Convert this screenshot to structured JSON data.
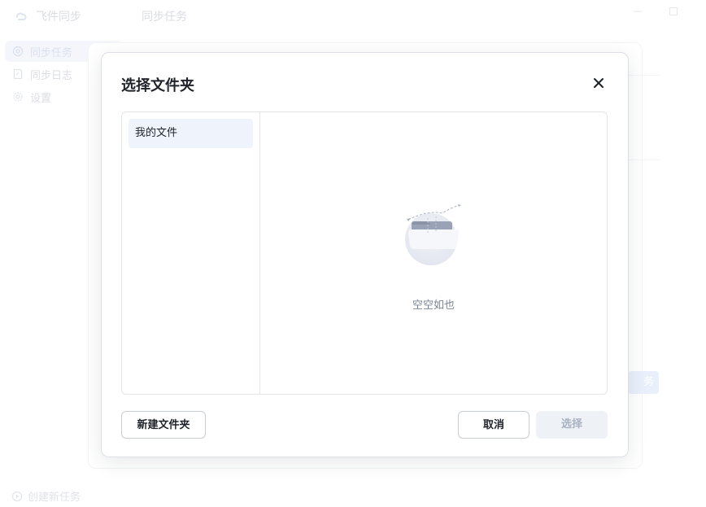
{
  "app": {
    "name": "飞件同步",
    "page_title": "同步任务",
    "sidebar": {
      "items": [
        {
          "label": "同步任务",
          "icon": "sync-icon",
          "active": true
        },
        {
          "label": "同步日志",
          "icon": "log-icon",
          "active": false
        },
        {
          "label": "设置",
          "icon": "gear-icon",
          "active": false
        }
      ]
    },
    "create_task_label": "创建新任务",
    "bg_button_label": "务"
  },
  "dialog": {
    "title": "选择文件夹",
    "close_icon": "close-icon",
    "tree": {
      "items": [
        {
          "label": "我的文件",
          "selected": true
        }
      ]
    },
    "empty_state": {
      "icon": "empty-folder-icon",
      "text": "空空如也"
    },
    "buttons": {
      "new_folder": "新建文件夹",
      "cancel": "取消",
      "select": "选择"
    }
  },
  "colors": {
    "accent_light": "#eef3fc",
    "border": "#e3e5e9",
    "text": "#1f2329",
    "muted": "#7a8494",
    "disabled_bg": "#eef1f6",
    "disabled_text": "#a8b1c0"
  }
}
